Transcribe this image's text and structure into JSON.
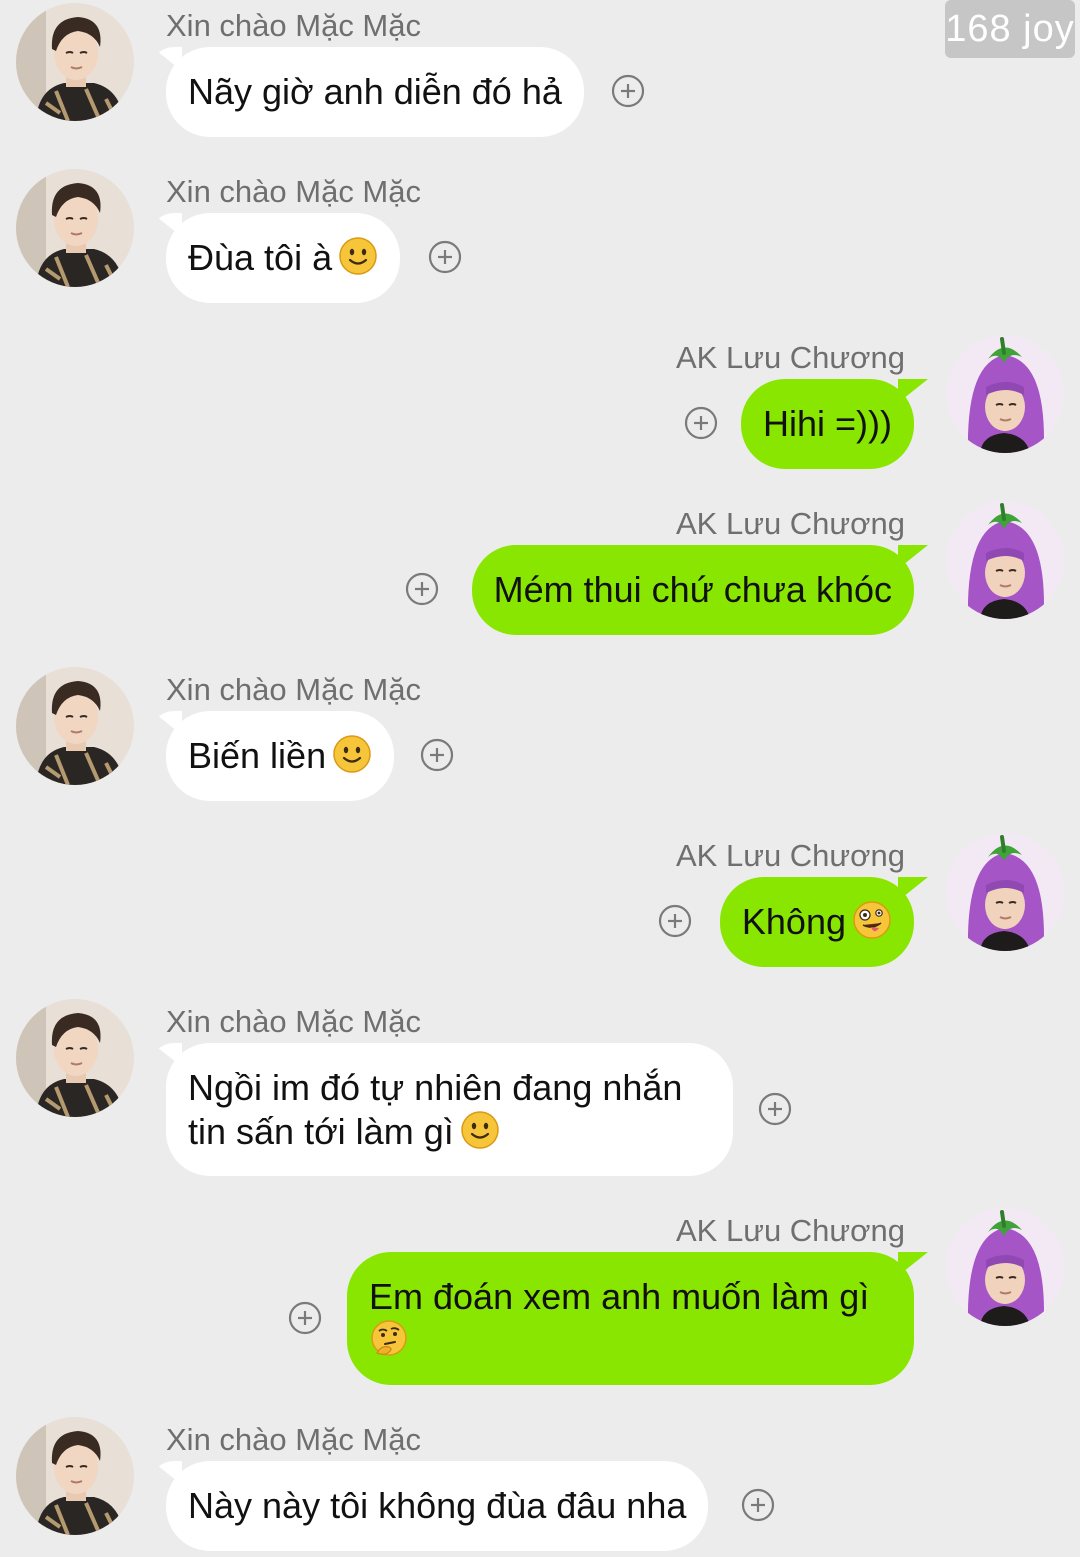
{
  "watermark": "168 joy",
  "users": {
    "left": "Xin chào Mặc Mặc",
    "right": "AK Lưu Chương"
  },
  "messages": [
    {
      "side": "left",
      "name": "Xin chào Mặc Mặc",
      "text": "Nãy giờ anh diễn đó hả"
    },
    {
      "side": "left",
      "name": "Xin chào Mặc Mặc",
      "text": "Đùa tôi à",
      "emoji": "slightly-smiling-emoji"
    },
    {
      "side": "right",
      "name": "AK Lưu Chương",
      "text": "Hihi =)))"
    },
    {
      "side": "right",
      "name": "AK Lưu Chương",
      "text": "Mém thui chứ chưa khóc"
    },
    {
      "side": "left",
      "name": "Xin chào Mặc Mặc",
      "text": "Biến liền",
      "emoji": "slightly-smiling-emoji"
    },
    {
      "side": "right",
      "name": "AK Lưu Chương",
      "text": "Không",
      "emoji": "zany-face-emoji"
    },
    {
      "side": "left",
      "name": "Xin chào Mặc Mặc",
      "text": "Ngồi im đó tự nhiên đang nhắn tin sấn tới làm gì",
      "emoji": "slightly-smiling-emoji"
    },
    {
      "side": "right",
      "name": "AK Lưu Chương",
      "text": "Em đoán xem anh muốn làm gì",
      "emoji": "thinking-face-emoji"
    },
    {
      "side": "left",
      "name": "Xin chào Mặc Mặc",
      "text": "Này này tôi không đùa đâu nha"
    }
  ],
  "icons": {
    "react": "plus-circle-icon",
    "left_avatar": "avatar-man-photo",
    "right_avatar": "avatar-eggplant-hat"
  },
  "colors": {
    "background": "#ececec",
    "incoming_bubble": "#ffffff",
    "outgoing_bubble": "#89e600",
    "name_text": "#6f6f6f",
    "emoji_yellow": "#f7c53a"
  }
}
